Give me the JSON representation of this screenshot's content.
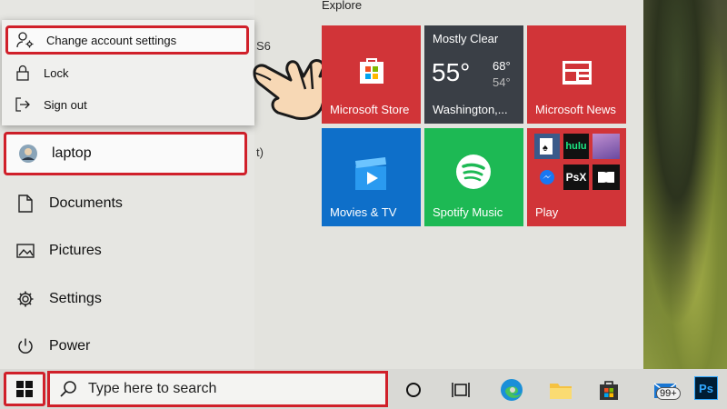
{
  "account_menu": {
    "items": [
      {
        "label": "Change account settings",
        "icon": "person-gear-icon"
      },
      {
        "label": "Lock",
        "icon": "lock-icon"
      },
      {
        "label": "Sign out",
        "icon": "sign-out-icon"
      }
    ]
  },
  "left_nav": {
    "user": {
      "label": "laptop",
      "icon": "avatar"
    },
    "items": [
      {
        "label": "Documents",
        "icon": "document-icon"
      },
      {
        "label": "Pictures",
        "icon": "pictures-icon"
      },
      {
        "label": "Settings",
        "icon": "gear-icon"
      },
      {
        "label": "Power",
        "icon": "power-icon"
      }
    ]
  },
  "applist_peek": [
    "S6",
    "t)"
  ],
  "tiles": {
    "section_label": "Explore",
    "store": {
      "label": "Microsoft Store",
      "color": "#d13438"
    },
    "weather": {
      "condition": "Mostly Clear",
      "temp": "55°",
      "high": "68°",
      "low": "54°",
      "location": "Washington,...",
      "color": "#3a3f46"
    },
    "news": {
      "label": "Microsoft News",
      "color": "#d13438"
    },
    "movies": {
      "label": "Movies & TV",
      "color": "#0e6fc9"
    },
    "spotify": {
      "label": "Spotify Music",
      "color": "#1db954"
    },
    "play": {
      "label": "Play",
      "color": "#d13438",
      "apps": [
        "hulu",
        "PsX"
      ]
    }
  },
  "taskbar": {
    "search_placeholder": "Type here to search",
    "mail_badge": "99+",
    "ps_label": "Ps"
  },
  "colors": {
    "highlight": "#d0202a",
    "accent": "#0078d4"
  }
}
